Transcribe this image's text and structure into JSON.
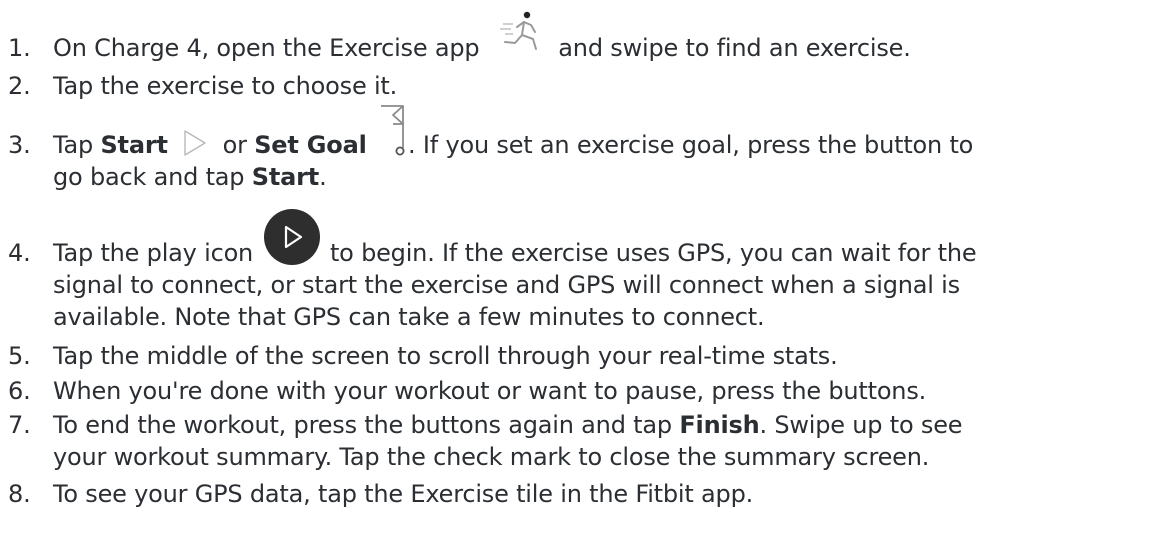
{
  "steps": [
    {
      "num": "1.",
      "t1": "On Charge 4, open the Exercise app",
      "t2": "and swipe to find an exercise."
    },
    {
      "num": "2.",
      "t1": "Tap the exercise to choose it."
    },
    {
      "num": "3.",
      "t1": "Tap",
      "b1": "Start",
      "t2": "or",
      "b2": "Set Goal",
      "t3": ". If you set an exercise goal, press the button to",
      "l2a": "go back and tap",
      "l2b": "Start",
      "l2c": "."
    },
    {
      "num": "4.",
      "t1": "Tap the play icon",
      "t2": "to begin. If the exercise uses GPS, you can wait for the",
      "l2": "signal to connect, or start the exercise and GPS will connect when a signal is",
      "l3": "available. Note that GPS can take a few minutes to connect."
    },
    {
      "num": "5.",
      "t1": "Tap the middle of the screen to scroll through your real-time stats."
    },
    {
      "num": "6.",
      "t1": "When you're done with your workout or want to pause, press the buttons."
    },
    {
      "num": "7.",
      "t1": "To end the workout, press the buttons again and tap",
      "b1": "Finish",
      "t2": ". Swipe up to see",
      "l2": "your workout summary. Tap the check mark to close the summary screen."
    },
    {
      "num": "8.",
      "t1": "To see your GPS data, tap the Exercise tile in the Fitbit app."
    }
  ],
  "icons": {
    "exercise": "exercise-app-icon",
    "start": "play-outline-icon",
    "goal": "goal-flag-icon",
    "play": "play-button-icon"
  },
  "colors": {
    "text": "#2b2f33",
    "icon_gray": "#9a9a9a",
    "play_bg": "#2e2e2e"
  }
}
